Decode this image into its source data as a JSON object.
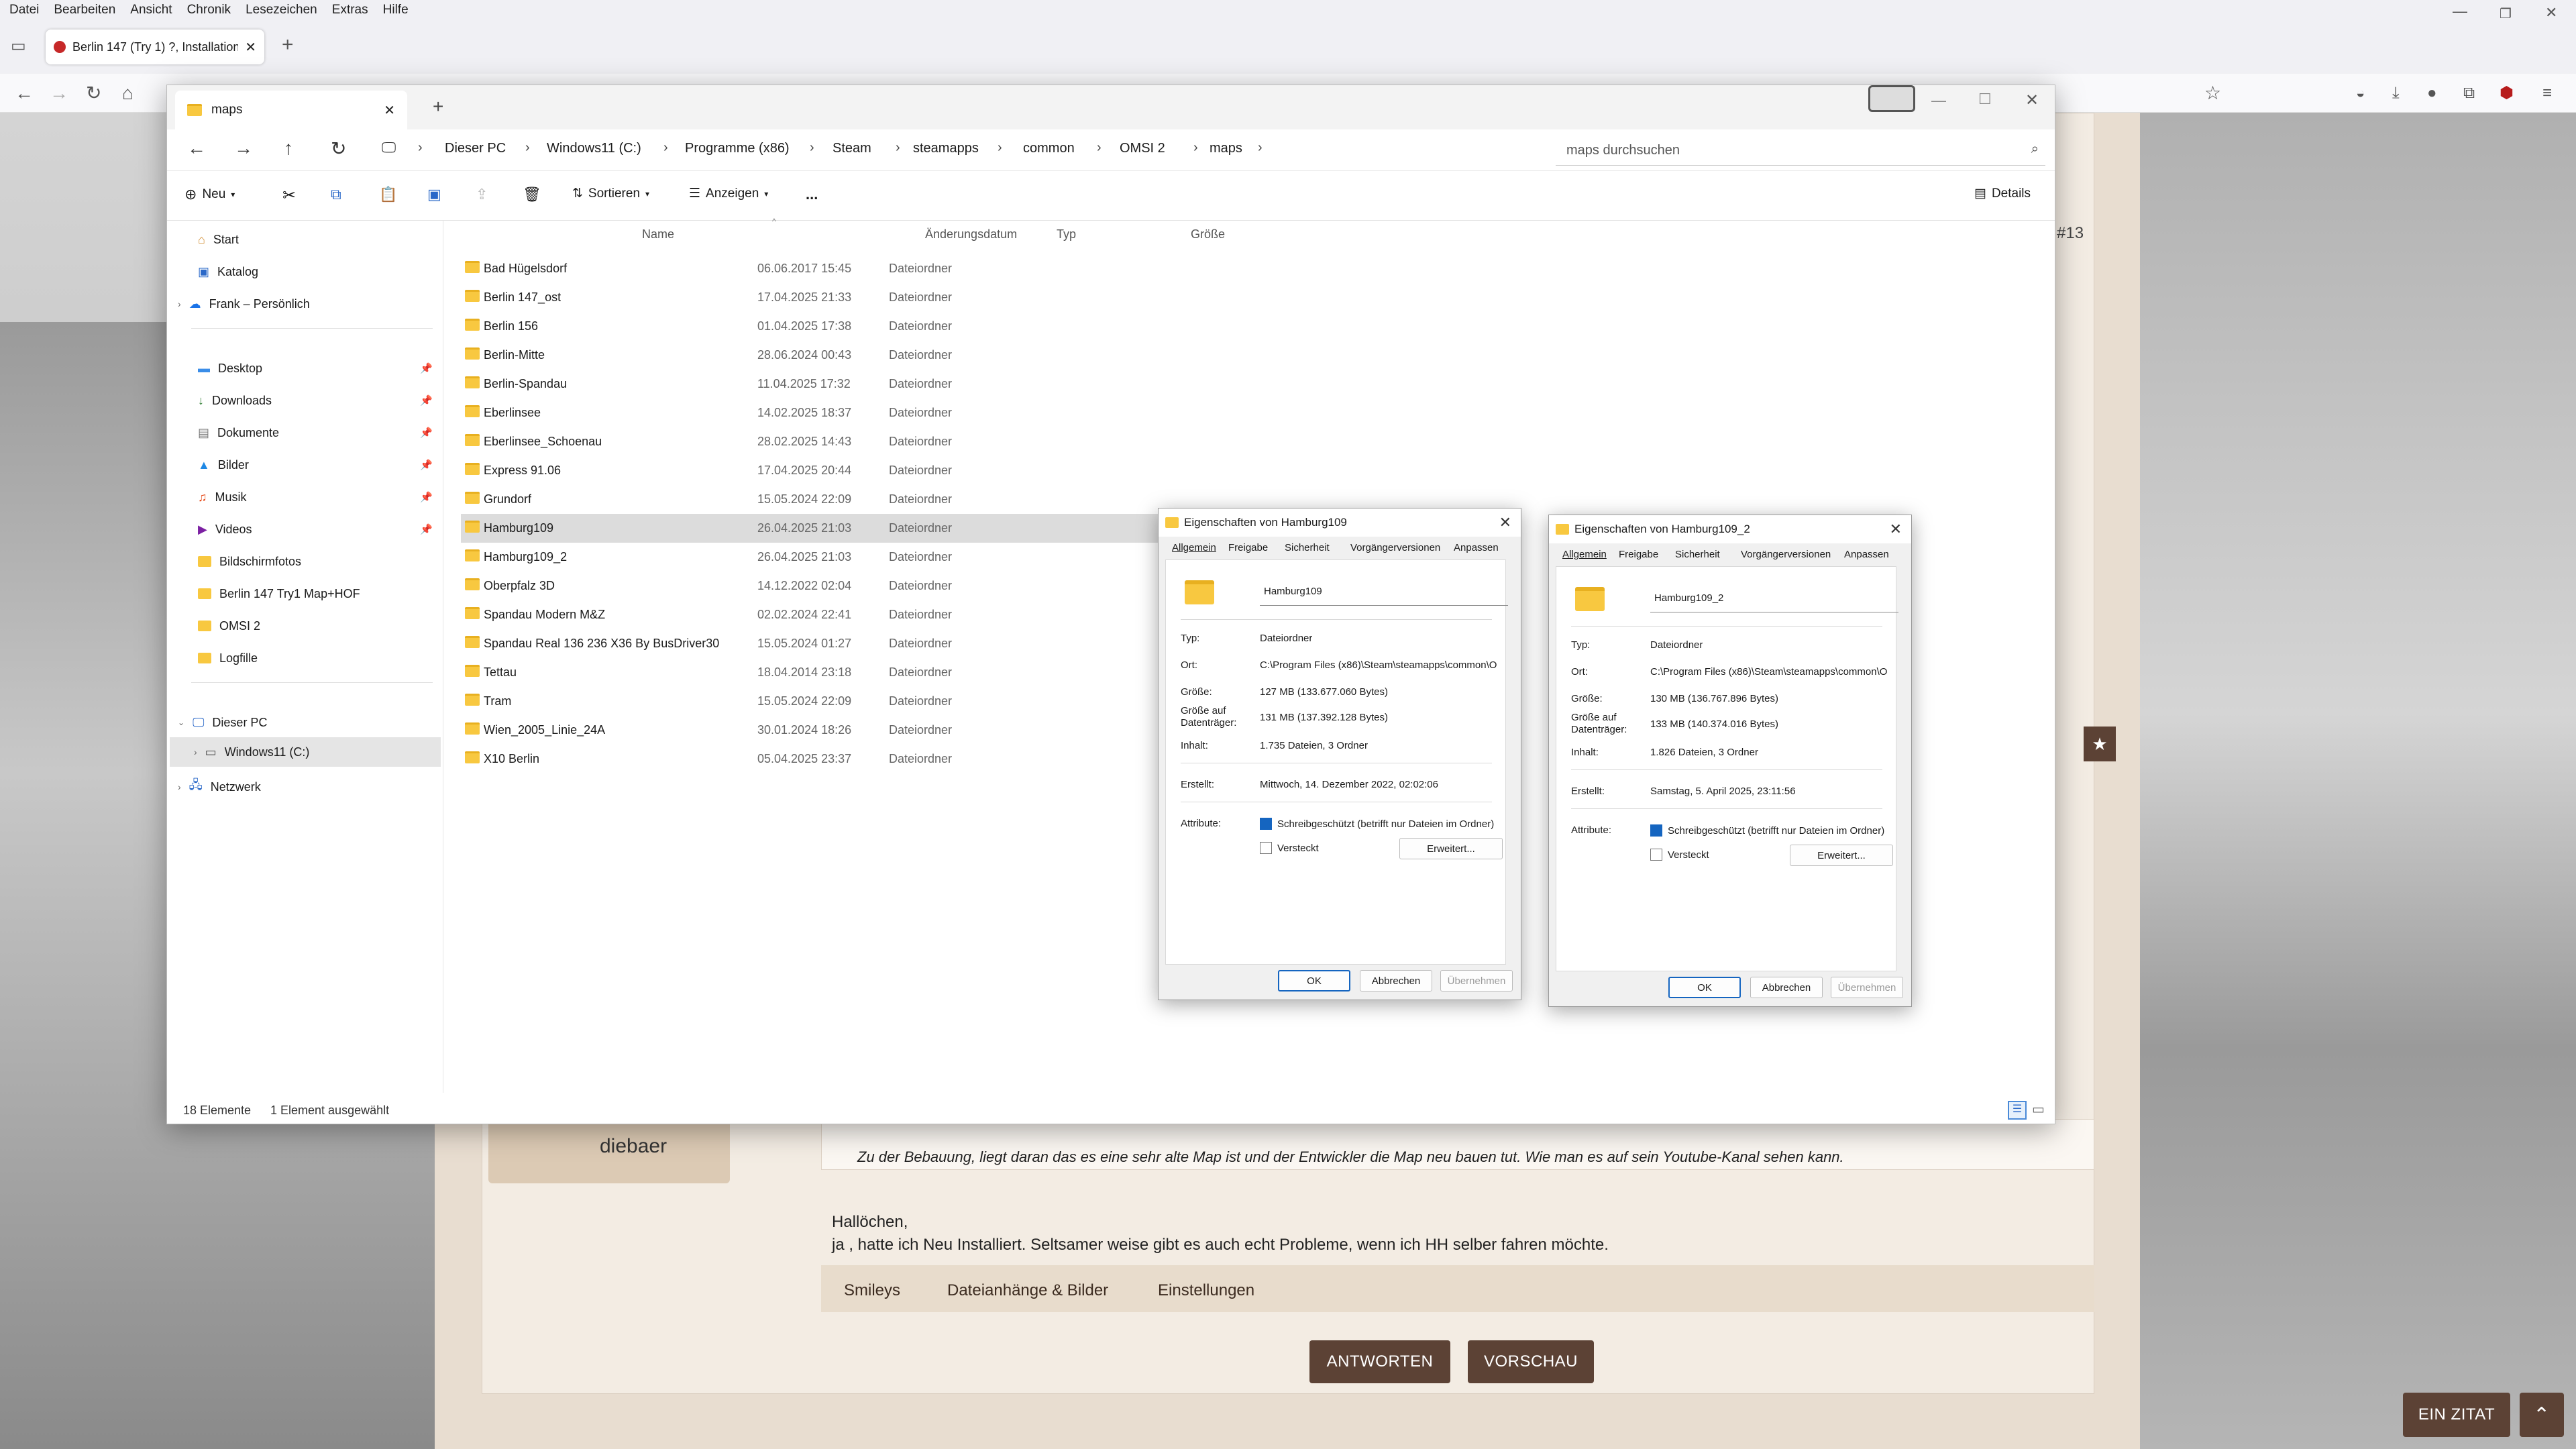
{
  "browser": {
    "menu": [
      "Datei",
      "Bearbeiten",
      "Ansicht",
      "Chronik",
      "Lesezeichen",
      "Extras",
      "Hilfe"
    ],
    "tab_title": "Berlin 147 (Try 1) ?, Installation ..."
  },
  "forum": {
    "post_number": "#13",
    "username": "diebaer",
    "quote": "Zu der Bebauung, liegt daran das es eine sehr alte Map ist und der Entwickler die Map neu bauen tut. Wie man es auf sein Youtube-Kanal sehen kann.",
    "reply_line1": "Hallöchen,",
    "reply_line2": "ja , hatte ich Neu Installiert. Seltsamer weise gibt es auch echt Probleme, wenn ich HH selber fahren möchte.",
    "editor_tabs": [
      "Smileys",
      "Dateianhänge & Bilder",
      "Einstellungen"
    ],
    "reply_button": "ANTWORTEN",
    "preview_button": "VORSCHAU",
    "quote_button": "EIN ZITAT"
  },
  "explorer": {
    "tab_title": "maps",
    "breadcrumb": [
      "Dieser PC",
      "Windows11 (C:)",
      "Programme (x86)",
      "Steam",
      "steamapps",
      "common",
      "OMSI 2",
      "maps"
    ],
    "search_placeholder": "maps durchsuchen",
    "commands": {
      "new": "Neu",
      "sort": "Sortieren",
      "view": "Anzeigen",
      "details": "Details",
      "more": "..."
    },
    "nav": {
      "top": [
        "Start",
        "Katalog",
        "Frank – Persönlich"
      ],
      "quick": [
        "Desktop",
        "Downloads",
        "Dokumente",
        "Bilder",
        "Musik",
        "Videos",
        "Bildschirmfotos",
        "Berlin 147 Try1 Map+HOF",
        "OMSI 2",
        "Logfille"
      ],
      "pc": [
        "Dieser PC",
        "Windows11 (C:)",
        "Netzwerk"
      ]
    },
    "columns": [
      "Name",
      "Änderungsdatum",
      "Typ",
      "Größe"
    ],
    "files": [
      {
        "name": "Bad Hügelsdorf",
        "date": "06.06.2017 15:45",
        "type": "Dateiordner"
      },
      {
        "name": "Berlin 147_ost",
        "date": "17.04.2025 21:33",
        "type": "Dateiordner"
      },
      {
        "name": "Berlin 156",
        "date": "01.04.2025 17:38",
        "type": "Dateiordner"
      },
      {
        "name": "Berlin-Mitte",
        "date": "28.06.2024 00:43",
        "type": "Dateiordner"
      },
      {
        "name": "Berlin-Spandau",
        "date": "11.04.2025 17:32",
        "type": "Dateiordner"
      },
      {
        "name": "Eberlinsee",
        "date": "14.02.2025 18:37",
        "type": "Dateiordner"
      },
      {
        "name": "Eberlinsee_Schoenau",
        "date": "28.02.2025 14:43",
        "type": "Dateiordner"
      },
      {
        "name": "Express 91.06",
        "date": "17.04.2025 20:44",
        "type": "Dateiordner"
      },
      {
        "name": "Grundorf",
        "date": "15.05.2024 22:09",
        "type": "Dateiordner"
      },
      {
        "name": "Hamburg109",
        "date": "26.04.2025 21:03",
        "type": "Dateiordner"
      },
      {
        "name": "Hamburg109_2",
        "date": "26.04.2025 21:03",
        "type": "Dateiordner"
      },
      {
        "name": "Oberpfalz 3D",
        "date": "14.12.2022 02:04",
        "type": "Dateiordner"
      },
      {
        "name": "Spandau Modern M&Z",
        "date": "02.02.2024 22:41",
        "type": "Dateiordner"
      },
      {
        "name": "Spandau Real 136 236 X36 By BusDriver30",
        "date": "15.05.2024 01:27",
        "type": "Dateiordner"
      },
      {
        "name": "Tettau",
        "date": "18.04.2014 23:18",
        "type": "Dateiordner"
      },
      {
        "name": "Tram",
        "date": "15.05.2024 22:09",
        "type": "Dateiordner"
      },
      {
        "name": "Wien_2005_Linie_24A",
        "date": "30.01.2024 18:26",
        "type": "Dateiordner"
      },
      {
        "name": "X10 Berlin",
        "date": "05.04.2025 23:37",
        "type": "Dateiordner"
      }
    ],
    "status_count": "18 Elemente",
    "status_selected": "1 Element ausgewählt"
  },
  "dialogs": [
    {
      "title": "Eigenschaften von Hamburg109",
      "tabs": [
        "Allgemein",
        "Freigabe",
        "Sicherheit",
        "Vorgängerversionen",
        "Anpassen"
      ],
      "name": "Hamburg109",
      "labels": {
        "type": "Typ:",
        "loc": "Ort:",
        "size": "Größe:",
        "disk1": "Größe auf",
        "disk2": "Datenträger:",
        "content": "Inhalt:",
        "created": "Erstellt:",
        "attr": "Attribute:"
      },
      "type": "Dateiordner",
      "location": "C:\\Program Files (x86)\\Steam\\steamapps\\common\\O",
      "size": "127 MB (133.677.060 Bytes)",
      "disk": "131 MB (137.392.128 Bytes)",
      "content": "1.735 Dateien, 3 Ordner",
      "created": "Mittwoch, 14. Dezember 2022, 02:02:06",
      "readonly": "Schreibgeschützt (betrifft nur Dateien im Ordner)",
      "hidden": "Versteckt",
      "advanced": "Erweitert...",
      "ok": "OK",
      "cancel": "Abbrechen",
      "apply": "Übernehmen"
    },
    {
      "title": "Eigenschaften von Hamburg109_2",
      "tabs": [
        "Allgemein",
        "Freigabe",
        "Sicherheit",
        "Vorgängerversionen",
        "Anpassen"
      ],
      "name": "Hamburg109_2",
      "labels": {
        "type": "Typ:",
        "loc": "Ort:",
        "size": "Größe:",
        "disk1": "Größe auf",
        "disk2": "Datenträger:",
        "content": "Inhalt:",
        "created": "Erstellt:",
        "attr": "Attribute:"
      },
      "type": "Dateiordner",
      "location": "C:\\Program Files (x86)\\Steam\\steamapps\\common\\O",
      "size": "130 MB (136.767.896 Bytes)",
      "disk": "133 MB (140.374.016 Bytes)",
      "content": "1.826 Dateien, 3 Ordner",
      "created": "Samstag, 5. April 2025, 23:11:56",
      "readonly": "Schreibgeschützt (betrifft nur Dateien im Ordner)",
      "hidden": "Versteckt",
      "advanced": "Erweitert...",
      "ok": "OK",
      "cancel": "Abbrechen",
      "apply": "Übernehmen"
    }
  ]
}
